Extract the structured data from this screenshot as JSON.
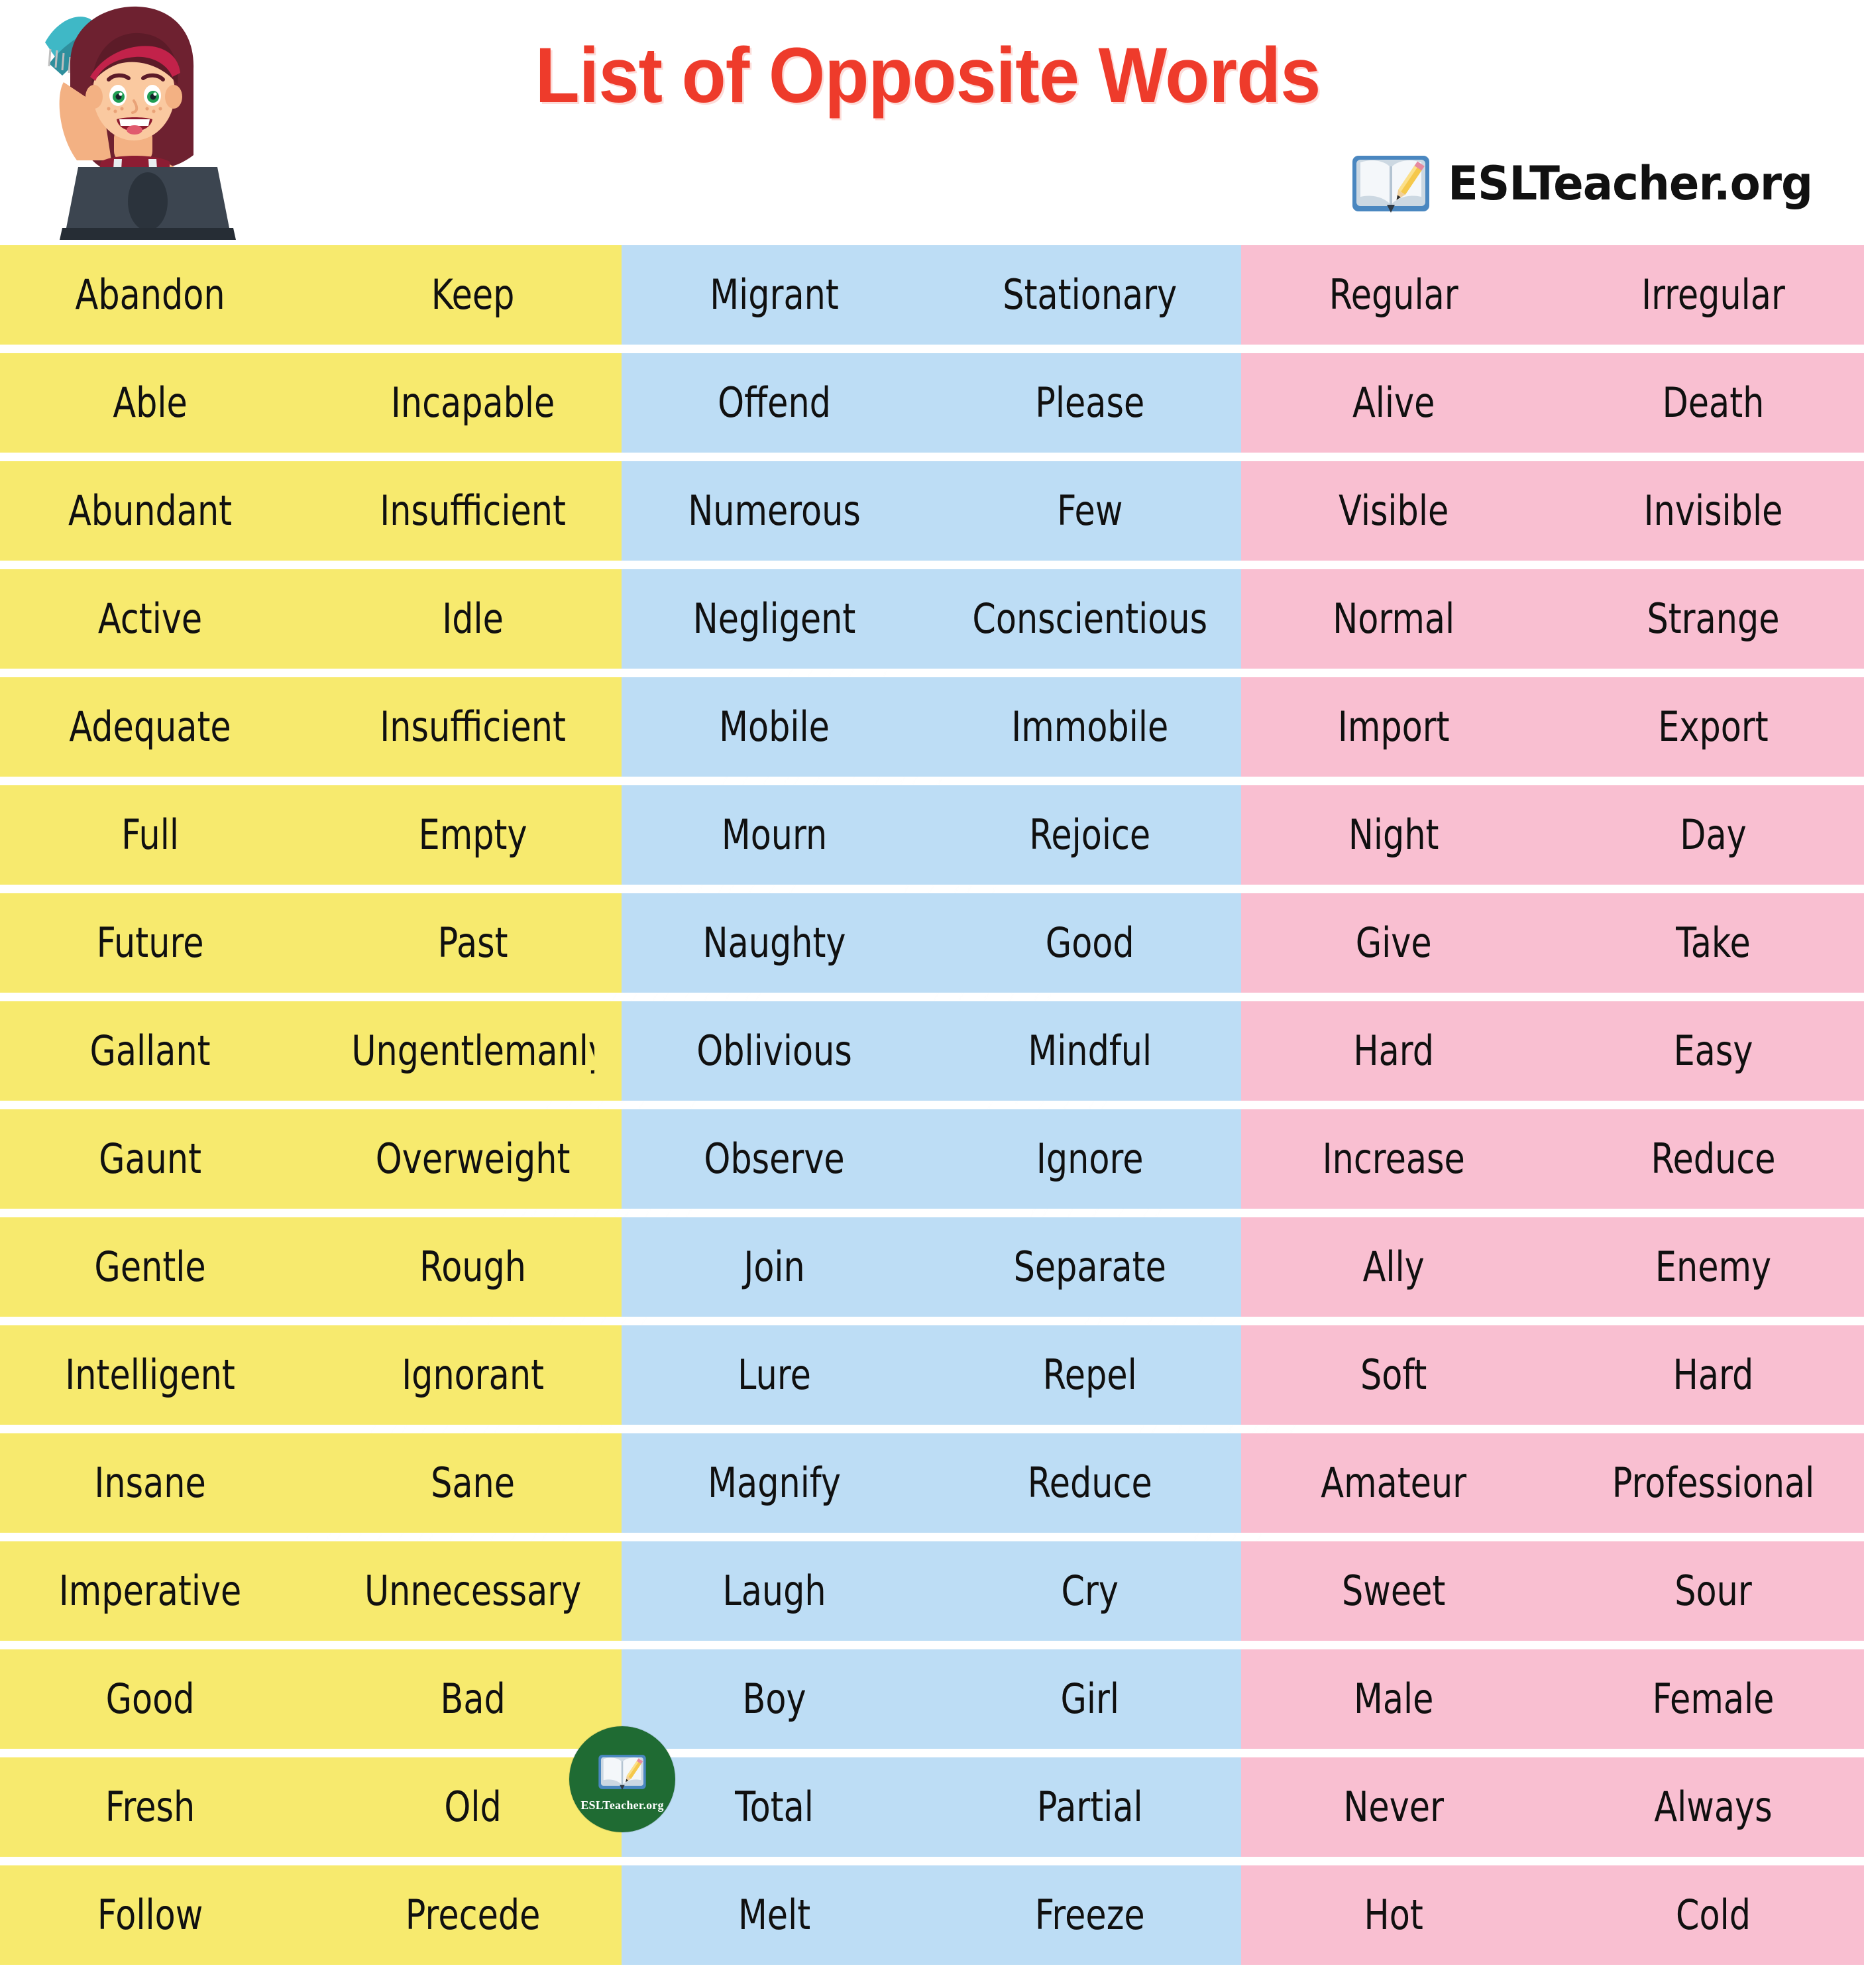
{
  "header": {
    "title": "List of Opposite Words",
    "brand_name": "ESLTeacher.org",
    "title_color": "#ee3b2b",
    "illustration": "girl-with-laptop-illustration",
    "logo_icon": "open-book-with-pencil-icon"
  },
  "badge": {
    "text": "ESLTeacher.org",
    "icon": "open-book-with-pencil-icon",
    "color": "#1f6b33"
  },
  "colors": {
    "yellow": "#f7ea6e",
    "blue": "#bdddf5",
    "pink": "#f9bfd1",
    "title_red": "#ee3b2b",
    "text": "#101010",
    "background": "#ffffff"
  },
  "table": {
    "columns": [
      {
        "key": "yellow",
        "color": "#f7ea6e"
      },
      {
        "key": "blue",
        "color": "#bdddf5"
      },
      {
        "key": "pink",
        "color": "#f9bfd1"
      }
    ],
    "rows": [
      {
        "yellow": [
          "Abandon",
          "Keep"
        ],
        "blue": [
          "Migrant",
          "Stationary"
        ],
        "pink": [
          "Regular",
          "Irregular"
        ]
      },
      {
        "yellow": [
          "Able",
          "Incapable"
        ],
        "blue": [
          "Offend",
          "Please"
        ],
        "pink": [
          "Alive",
          "Death"
        ]
      },
      {
        "yellow": [
          "Abundant",
          "Insufficient"
        ],
        "blue": [
          "Numerous",
          "Few"
        ],
        "pink": [
          "Visible",
          "Invisible"
        ]
      },
      {
        "yellow": [
          "Active",
          "Idle"
        ],
        "blue": [
          "Negligent",
          "Conscientious"
        ],
        "pink": [
          "Normal",
          "Strange"
        ]
      },
      {
        "yellow": [
          "Adequate",
          "Insufficient"
        ],
        "blue": [
          "Mobile",
          "Immobile"
        ],
        "pink": [
          "Import",
          "Export"
        ]
      },
      {
        "yellow": [
          "Full",
          "Empty"
        ],
        "blue": [
          "Mourn",
          "Rejoice"
        ],
        "pink": [
          "Night",
          "Day"
        ]
      },
      {
        "yellow": [
          "Future",
          "Past"
        ],
        "blue": [
          "Naughty",
          "Good"
        ],
        "pink": [
          "Give",
          "Take"
        ]
      },
      {
        "yellow": [
          "Gallant",
          "Ungentlemanly"
        ],
        "blue": [
          "Oblivious",
          "Mindful"
        ],
        "pink": [
          "Hard",
          "Easy"
        ]
      },
      {
        "yellow": [
          "Gaunt",
          "Overweight"
        ],
        "blue": [
          "Observe",
          "Ignore"
        ],
        "pink": [
          "Increase",
          "Reduce"
        ]
      },
      {
        "yellow": [
          "Gentle",
          "Rough"
        ],
        "blue": [
          "Join",
          "Separate"
        ],
        "pink": [
          "Ally",
          "Enemy"
        ]
      },
      {
        "yellow": [
          "Intelligent",
          "Ignorant"
        ],
        "blue": [
          "Lure",
          "Repel"
        ],
        "pink": [
          "Soft",
          "Hard"
        ]
      },
      {
        "yellow": [
          "Insane",
          "Sane"
        ],
        "blue": [
          "Magnify",
          "Reduce"
        ],
        "pink": [
          "Amateur",
          "Professional"
        ]
      },
      {
        "yellow": [
          "Imperative",
          "Unnecessary"
        ],
        "blue": [
          "Laugh",
          "Cry"
        ],
        "pink": [
          "Sweet",
          "Sour"
        ]
      },
      {
        "yellow": [
          "Good",
          "Bad"
        ],
        "blue": [
          "Boy",
          "Girl"
        ],
        "pink": [
          "Male",
          "Female"
        ]
      },
      {
        "yellow": [
          "Fresh",
          "Old"
        ],
        "blue": [
          "Total",
          "Partial"
        ],
        "pink": [
          "Never",
          "Always"
        ]
      },
      {
        "yellow": [
          "Follow",
          "Precede"
        ],
        "blue": [
          "Melt",
          "Freeze"
        ],
        "pink": [
          "Hot",
          "Cold"
        ]
      }
    ]
  }
}
